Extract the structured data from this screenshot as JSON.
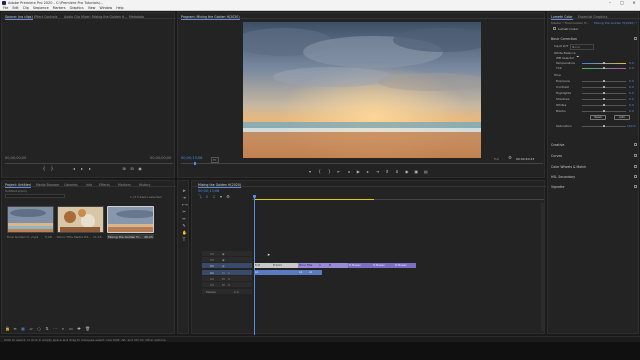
{
  "window": {
    "title": "Adobe Premiere Pro 2020 - C:\\Premiere Pro Tutorials\\...",
    "controls": [
      "–",
      "□",
      "✕"
    ]
  },
  "menu": [
    "File",
    "Edit",
    "Clip",
    "Sequence",
    "Markers",
    "Graphics",
    "View",
    "Window",
    "Help"
  ],
  "source_panel": {
    "tabs": [
      "Source: (no clips)",
      "Effect Controls",
      "Audio Clip Mixer: Mixing the Golden H...",
      "Metadata"
    ],
    "timecode_left": "00;00;00;00",
    "timecode_right": "00;00;00;00"
  },
  "program_panel": {
    "tab": "Program: Mixing the Golden H(2020)",
    "timecode": "00;00;13;06",
    "zoom": "Fit",
    "quality": "Full",
    "duration": "00;00;40;23"
  },
  "project_panel": {
    "tabs": [
      "Project: Untitled",
      "Media Browser",
      "Libraries",
      "Info",
      "Effects",
      "Markers",
      "History"
    ],
    "path": "Untitled.prproj",
    "item_count": "1 of 3 items selected",
    "items": [
      {
        "name": "Final Golden H...mp4",
        "duration": "5;08"
      },
      {
        "name": "Picnic Title Media Hd...",
        "duration": "11;15"
      },
      {
        "name": "Mixing the Golden H...",
        "duration": "40;23"
      }
    ]
  },
  "timeline": {
    "tab": "Mixing the Golden H(2020)",
    "timecode": "00;00;13;06",
    "tracks_video": [
      "V3",
      "V2",
      "V1"
    ],
    "tracks_audio": [
      "A1",
      "A2",
      "A3"
    ],
    "master_label": "Master",
    "master_value": "0.0",
    "fx_clips": [
      "fx Mosaic",
      "fx Mosaic",
      "fx Mosaic"
    ],
    "v1_clips": [
      "Fold",
      "B Solid",
      "Picnic Title",
      "A",
      "B"
    ],
    "a1_clips": [
      "A1",
      "A1",
      "A1"
    ]
  },
  "lumetri": {
    "tabs": [
      "Lumetri Color",
      "Essential Graphics"
    ],
    "source_label": "Master * Final Golden H...",
    "clip_label": "Mixing the Golden H(2020) * Final Golden H...",
    "fx_name": "Lumetri Color",
    "sections": [
      "Basic Correction",
      "Creative",
      "Curves",
      "Color Wheels & Match",
      "HSL Secondary",
      "Vignette"
    ],
    "input_lut_label": "Input LUT",
    "input_lut_value": "None",
    "white_balance_label": "White Balance",
    "wb_selector": "WB Selector",
    "temperature_label": "Temperature",
    "temperature": "0.0",
    "tint_label": "Tint",
    "tint": "0.0",
    "tone_label": "Tone",
    "exposure_label": "Exposure",
    "exposure": "0.0",
    "contrast_label": "Contrast",
    "contrast": "0.0",
    "highlights_label": "Highlights",
    "highlights": "0.0",
    "shadows_label": "Shadows",
    "shadows": "0.0",
    "whites_label": "Whites",
    "whites": "0.0",
    "blacks_label": "Blacks",
    "blacks": "0.0",
    "reset_label": "Reset",
    "auto_label": "Auto",
    "saturation_label": "Saturation",
    "saturation": "100.0"
  },
  "status_bar": "Click to select, or click in empty space and drag to marquee select. Use Shift, Alt, and Ctrl for other options.",
  "colors": {
    "accent": "#4f8fe6",
    "clip_fx": "#9b8ad8",
    "clip_video": "#7a70c6",
    "clip_audio": "#5a7bbf",
    "work_area": "#e6c800"
  }
}
